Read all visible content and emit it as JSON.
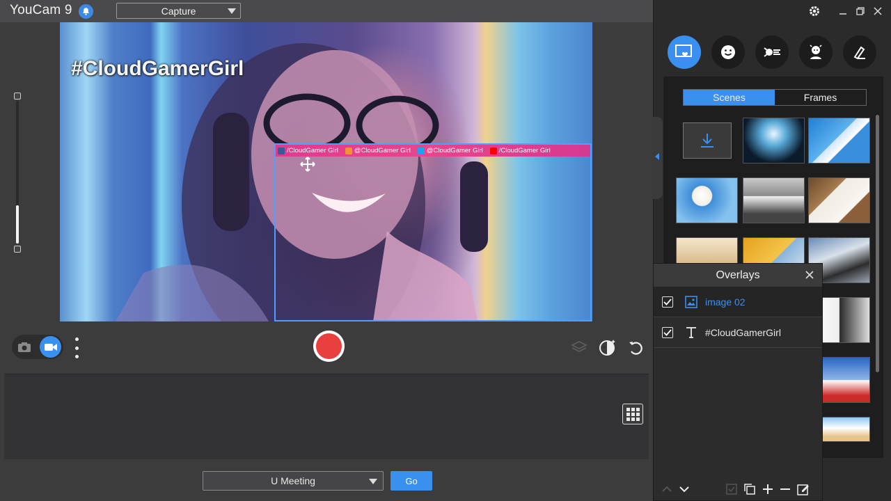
{
  "app": {
    "title": "YouCam 9"
  },
  "toolbar": {
    "mode_select": "Capture"
  },
  "preview": {
    "hashtag_overlay": "#CloudGamerGirl",
    "social_bar": [
      {
        "icon": "facebook-icon",
        "color": "#3b5998",
        "text": "/CloudGamer Girl"
      },
      {
        "icon": "instagram-icon",
        "color": "#f09433",
        "text": "@CloudGamer Girl"
      },
      {
        "icon": "twitter-icon",
        "color": "#1da1f2",
        "text": "@CloudGamer Girl"
      },
      {
        "icon": "youtube-icon",
        "color": "#ff0000",
        "text": "/CloudGamer Girl"
      }
    ]
  },
  "zoom": {
    "level": 0.27
  },
  "bottom": {
    "meeting_select": "U Meeting",
    "go_label": "Go"
  },
  "right_panel": {
    "categories": [
      "scenes-frames-icon",
      "emoji-icon",
      "particle-icon",
      "avatar-icon",
      "brush-icon"
    ],
    "tabs": [
      "Scenes",
      "Frames"
    ],
    "active_tab": "Scenes"
  },
  "overlays_panel": {
    "title": "Overlays",
    "items": [
      {
        "type": "image",
        "label": "image 02",
        "checked": true,
        "selected": true
      },
      {
        "type": "text",
        "label": "#CloudGamerGirl",
        "checked": true,
        "selected": false
      }
    ]
  },
  "colors": {
    "accent": "#3a90ef",
    "record": "#ea3f3f",
    "overlay_bar": "#e9448c"
  }
}
